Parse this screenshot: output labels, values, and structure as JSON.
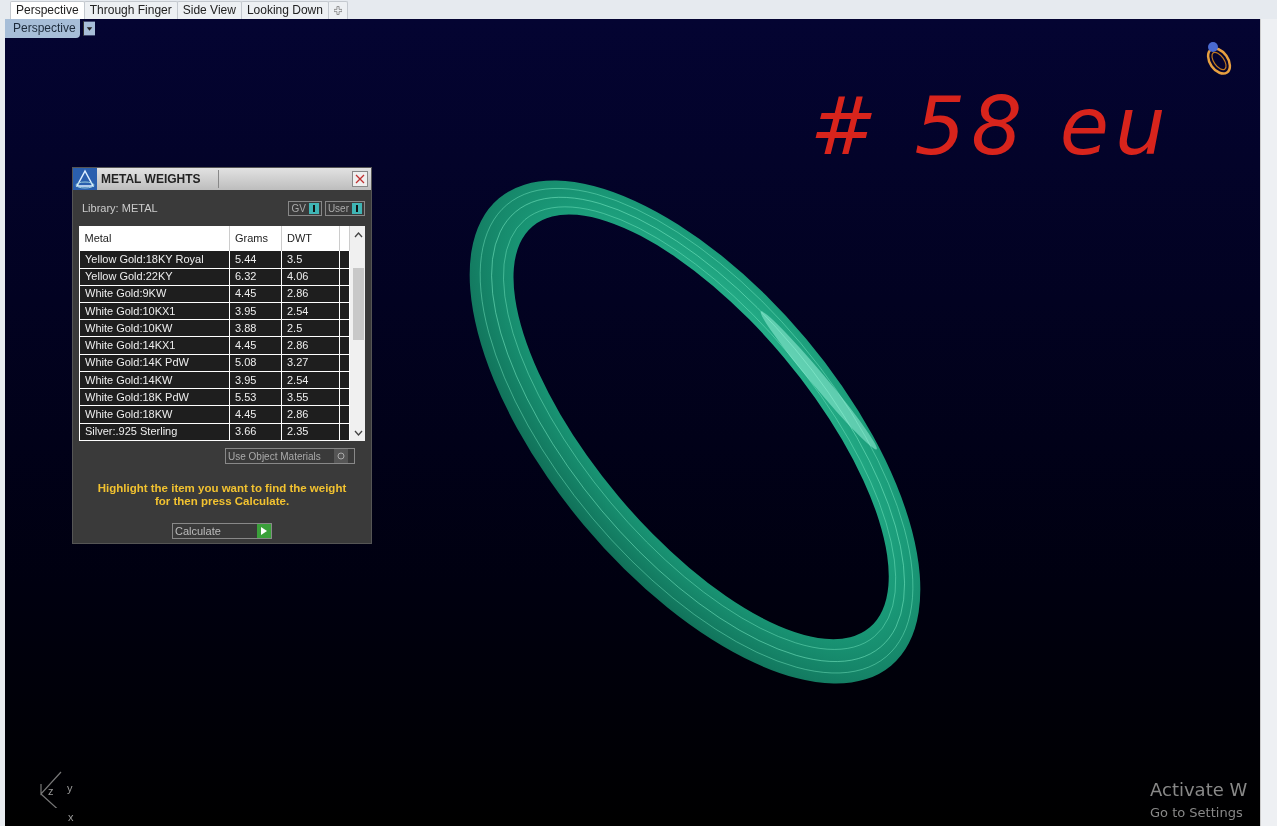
{
  "tabs": [
    {
      "label": "Perspective",
      "selected": true
    },
    {
      "label": "Through Finger",
      "selected": false
    },
    {
      "label": "Side View",
      "selected": false
    },
    {
      "label": "Looking Down",
      "selected": false
    }
  ],
  "viewport": {
    "label": "Perspective"
  },
  "annotation": "# 58 eu",
  "panel": {
    "title": "METAL WEIGHTS",
    "library": "Library: METAL",
    "toggles": [
      {
        "label": "GV",
        "on": true
      },
      {
        "label": "User",
        "on": true
      }
    ],
    "table": {
      "columns": [
        "Metal",
        "Grams",
        "DWT"
      ],
      "rows": [
        [
          "Yellow Gold:18KY Royal",
          "5.44",
          "3.5"
        ],
        [
          "Yellow Gold:22KY",
          "6.32",
          "4.06"
        ],
        [
          "White Gold:9KW",
          "4.45",
          "2.86"
        ],
        [
          "White Gold:10KX1",
          "3.95",
          "2.54"
        ],
        [
          "White Gold:10KW",
          "3.88",
          "2.5"
        ],
        [
          "White Gold:14KX1",
          "4.45",
          "2.86"
        ],
        [
          "White Gold:14K PdW",
          "5.08",
          "3.27"
        ],
        [
          "White Gold:14KW",
          "3.95",
          "2.54"
        ],
        [
          "White Gold:18K PdW",
          "5.53",
          "3.55"
        ],
        [
          "White Gold:18KW",
          "4.45",
          "2.86"
        ],
        [
          "Silver:.925 Sterling",
          "3.66",
          "2.35"
        ]
      ]
    },
    "use_object_materials": {
      "label": "Use Object Materials",
      "on": false
    },
    "hint": "Highlight the item you want to find the weight for then press Calculate.",
    "button": "Calculate"
  },
  "axes": {
    "z": "z",
    "y": "y",
    "x": "x"
  },
  "activation": [
    "Activate W",
    "Go to Settings"
  ]
}
